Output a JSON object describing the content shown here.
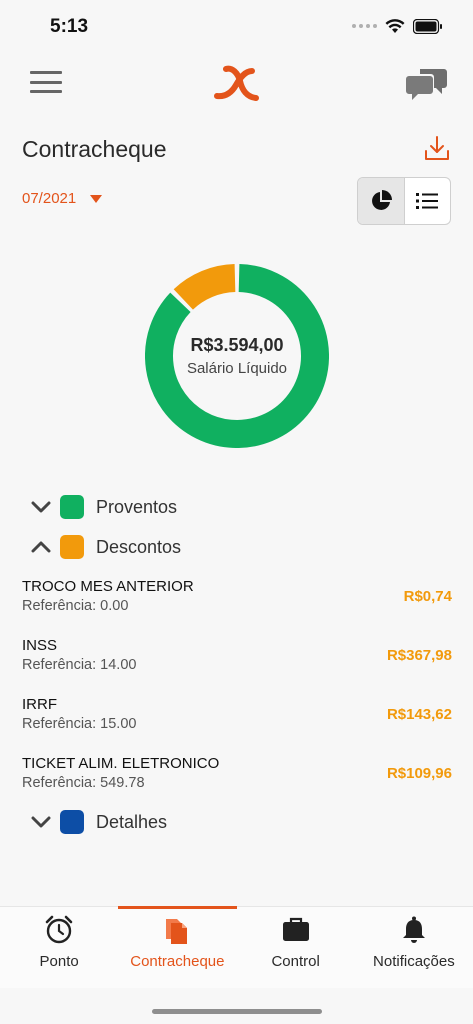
{
  "status_bar": {
    "time": "5:13"
  },
  "header": {
    "title": "Contracheque"
  },
  "period": {
    "selected": "07/2021"
  },
  "summary": {
    "amount": "R$3.594,00",
    "caption": "Salário Líquido",
    "proventos_fraction": 0.875,
    "descontos_fraction": 0.125
  },
  "colors": {
    "proventos": "#10b060",
    "descontos": "#f29a0c",
    "detalhes": "#0d4ea6",
    "accent": "#e3541b"
  },
  "legend": {
    "proventos": "Proventos",
    "descontos": "Descontos",
    "detalhes": "Detalhes"
  },
  "descontos_items": [
    {
      "name": "TROCO MES ANTERIOR",
      "ref": "Referência: 0.00",
      "value": "R$0,74"
    },
    {
      "name": "INSS",
      "ref": "Referência: 14.00",
      "value": "R$367,98"
    },
    {
      "name": "IRRF",
      "ref": "Referência: 15.00",
      "value": "R$143,62"
    },
    {
      "name": "TICKET ALIM. ELETRONICO",
      "ref": "Referência: 549.78",
      "value": "R$109,96"
    }
  ],
  "tabs": [
    {
      "label": "Ponto",
      "icon": "alarm-clock-icon"
    },
    {
      "label": "Contracheque",
      "icon": "document-icon"
    },
    {
      "label": "Control",
      "icon": "briefcase-icon"
    },
    {
      "label": "Notificações",
      "icon": "bell-icon"
    }
  ]
}
